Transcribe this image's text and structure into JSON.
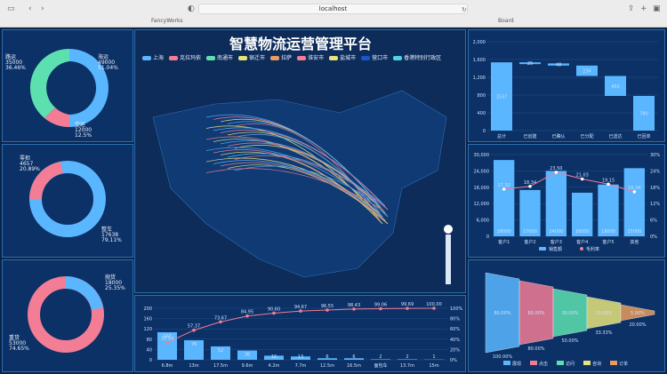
{
  "browser": {
    "url": "localhost",
    "tab_left": "FancyWorks",
    "tab_right": "Board"
  },
  "page_title": "智慧物流运营管理平台",
  "colors": {
    "blue": "#59b6ff",
    "pink": "#f27d95",
    "green": "#5de0b0",
    "orange": "#e89b5b",
    "yellow": "#e6e37a",
    "navy": "#1a55c9",
    "cyan": "#4fd1e8"
  },
  "map_legend": [
    "上海",
    "克拉玛依",
    "南通市",
    "宿迁市",
    "拉萨",
    "淮安市",
    "盐城市",
    "营口市",
    "香港特别行政区"
  ],
  "donut1": {
    "segments": [
      {
        "name": "海运",
        "value": "49000",
        "pct": "51.04%"
      },
      {
        "name": "空运",
        "value": "12000",
        "pct": "12.5%"
      },
      {
        "name": "路运",
        "value": "35000",
        "pct": "36.46%"
      }
    ]
  },
  "donut2": {
    "segments": [
      {
        "name": "整车",
        "value": "17638",
        "pct": "79.11%"
      },
      {
        "name": "零担",
        "value": "4657",
        "pct": "20.89%"
      }
    ]
  },
  "donut3": {
    "segments": [
      {
        "name": "重货",
        "value": "53000",
        "pct": "74.65%"
      },
      {
        "name": "抛货",
        "value": "18000",
        "pct": "25.35%"
      }
    ]
  },
  "chart_data": [
    {
      "type": "bar",
      "id": "waterfall",
      "categories": [
        "总计",
        "已创建",
        "已确认",
        "已分配",
        "已送达",
        "已回单"
      ],
      "values": [
        1537,
        25,
        48,
        234,
        450,
        780
      ],
      "ylim": [
        0,
        2000
      ],
      "yticks": [
        0,
        400,
        800,
        1200,
        1600,
        2000
      ]
    },
    {
      "type": "bar",
      "id": "sales",
      "categories": [
        "客户1",
        "客户2",
        "客户3",
        "客户4",
        "客户5",
        "其他"
      ],
      "series": [
        {
          "name": "销售额",
          "values": [
            28000,
            17000,
            24000,
            16000,
            19000,
            25000
          ]
        },
        {
          "name": "毛利率",
          "values": [
            17.32,
            18.34,
            23.5,
            21.03,
            19.15,
            16.34
          ]
        }
      ],
      "ylim": [
        0,
        30000
      ],
      "y2lim": [
        0,
        30
      ],
      "yticks": [
        0,
        6000,
        12000,
        18000,
        24000,
        30000
      ],
      "y2ticks": [
        "0%",
        "6%",
        "12%",
        "18%",
        "24%",
        "30%"
      ]
    },
    {
      "type": "bar",
      "id": "pareto",
      "categories": [
        "6.8m",
        "13m",
        "17.5m",
        "9.6m",
        "4.2m",
        "7.7m",
        "12.5m",
        "16.5m",
        "面包车",
        "13.7m",
        "15m"
      ],
      "values": [
        107,
        76,
        52,
        36,
        16,
        13,
        6,
        6,
        2,
        2,
        1
      ],
      "cumulative": [
        33.54,
        57.37,
        73.67,
        84.95,
        90.6,
        94.67,
        96.55,
        98.43,
        99.06,
        99.69,
        100
      ],
      "ylim": [
        0,
        200
      ],
      "yticks": [
        0,
        40,
        80,
        120,
        160,
        200
      ],
      "y2ticks": [
        "0%",
        "20%",
        "40%",
        "60%",
        "80%",
        "100%"
      ]
    },
    {
      "type": "funnel",
      "id": "funnel",
      "categories": [
        "展现",
        "点击",
        "访问",
        "咨询",
        "订单"
      ],
      "values": [
        80,
        60,
        30,
        10,
        5
      ],
      "labels": [
        "80.00%",
        "60.00%",
        "30.00%",
        "10.00%",
        "5.00%"
      ],
      "sublabels": [
        "100.00%",
        "80.00%",
        "50.00%",
        "33.33%",
        "20.00%"
      ]
    }
  ]
}
